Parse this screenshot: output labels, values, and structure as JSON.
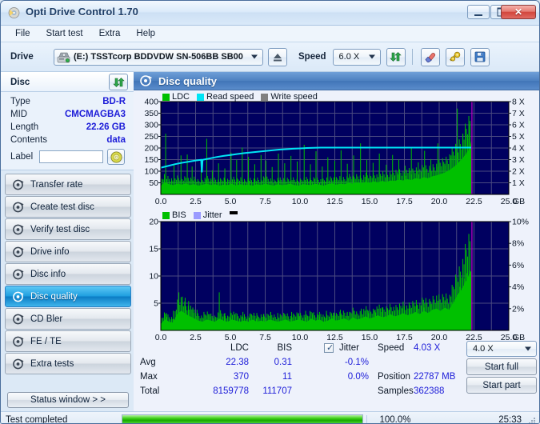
{
  "window": {
    "title": "Opti Drive Control 1.70",
    "icon": "disc-icon",
    "buttons": {
      "minimize": "minimize-icon",
      "maximize": "maximize-icon",
      "close": "close-icon"
    }
  },
  "menubar": {
    "items": [
      "File",
      "Start test",
      "Extra",
      "Help"
    ]
  },
  "toolbar": {
    "drive_label": "Drive",
    "drive_value": "(E:)   TSSTcorp BDDVDW SN-506BB SB00",
    "eject_icon": "eject-icon",
    "speed_label": "Speed",
    "speed_value": "6.0 X",
    "refresh_icon": "refresh-icon",
    "erase_icon": "eraser-icon",
    "settings_icon": "settings-icon",
    "save_icon": "save-icon"
  },
  "disc_panel": {
    "header": "Disc",
    "refresh_icon": "refresh-icon",
    "rows": [
      {
        "key": "Type",
        "value": "BD-R"
      },
      {
        "key": "MID",
        "value": "CMCMAGBA3"
      },
      {
        "key": "Length",
        "value": "22.26 GB"
      },
      {
        "key": "Contents",
        "value": "data"
      }
    ],
    "label_key": "Label",
    "label_value": "",
    "label_placeholder": "",
    "label_icon": "disc-icon"
  },
  "nav": {
    "items": [
      {
        "label": "Transfer rate",
        "icon": "disc-transfer-icon",
        "active": false
      },
      {
        "label": "Create test disc",
        "icon": "disc-create-icon",
        "active": false
      },
      {
        "label": "Verify test disc",
        "icon": "disc-verify-icon",
        "active": false
      },
      {
        "label": "Drive info",
        "icon": "drive-info-icon",
        "active": false
      },
      {
        "label": "Disc info",
        "icon": "disc-info-icon",
        "active": false
      },
      {
        "label": "Disc quality",
        "icon": "disc-quality-icon",
        "active": true
      },
      {
        "label": "CD Bler",
        "icon": "disc-bler-icon",
        "active": false
      },
      {
        "label": "FE / TE",
        "icon": "disc-fete-icon",
        "active": false
      },
      {
        "label": "Extra tests",
        "icon": "disc-extra-icon",
        "active": false
      }
    ],
    "status_window_button": "Status window > >"
  },
  "main": {
    "header_title": "Disc quality",
    "header_icon": "disc-quality-icon"
  },
  "stats": {
    "col_headers": [
      "LDC",
      "BIS"
    ],
    "row_labels": [
      "Avg",
      "Max",
      "Total"
    ],
    "ldc": {
      "avg": "22.38",
      "max": "370",
      "total": "8159778"
    },
    "bis": {
      "avg": "0.31",
      "max": "11",
      "total": "111707"
    },
    "jitter": {
      "label": "Jitter",
      "checked": true,
      "avg": "-0.1%",
      "max": "0.0%"
    },
    "speed_label": "Speed",
    "speed_value": "4.03 X",
    "position_label": "Position",
    "position_value": "22787 MB",
    "samples_label": "Samples",
    "samples_value": "362388",
    "speed_select": "4.0 X",
    "start_full": "Start full",
    "start_part": "Start part"
  },
  "statusbar": {
    "text": "Test completed",
    "percent": "100.0%",
    "progress": 100,
    "elapsed": "25:33",
    "grip_icon": "resize-grip-icon"
  },
  "colors": {
    "ldc_green": "#00c000",
    "read_speed_cyan": "#00e5f5",
    "write_speed_gray": "#808080",
    "bis_green": "#00c000",
    "jitter_blue": "#9a9aff",
    "plot_bg": "#000060",
    "grid": "#4a4a80",
    "marker_magenta": "#c000c0"
  },
  "chart_data": [
    {
      "type": "area",
      "id": "ldc-chart",
      "title": "",
      "xlabel": "GB",
      "ylabel": "",
      "xlim": [
        0,
        25
      ],
      "ylim": [
        0,
        400
      ],
      "y2lim": [
        0,
        8
      ],
      "y2label": "X",
      "grid": true,
      "legend_position": "top-left",
      "legend": [
        "LDC",
        "Read speed",
        "Write speed"
      ],
      "xticks": [
        "0.0",
        "2.5",
        "5.0",
        "7.5",
        "10.0",
        "12.5",
        "15.0",
        "17.5",
        "20.0",
        "22.5",
        "25.0"
      ],
      "yticks": [
        "50",
        "100",
        "150",
        "200",
        "250",
        "300",
        "350",
        "400"
      ],
      "y2ticks": [
        "1 X",
        "2 X",
        "3 X",
        "4 X",
        "5 X",
        "6 X",
        "7 X",
        "8 X"
      ],
      "data_end_x": 22.3,
      "series": [
        {
          "name": "LDC",
          "type": "area",
          "color": "#00c000",
          "x": [
            0.0,
            0.3,
            0.6,
            0.9,
            1.2,
            1.5,
            1.8,
            2.1,
            2.4,
            2.7,
            3.0,
            3.3,
            3.6,
            3.9,
            4.2,
            4.5,
            4.8,
            5.1,
            5.4,
            5.7,
            6.0,
            6.3,
            6.6,
            6.9,
            7.2,
            7.5,
            7.8,
            8.1,
            8.4,
            8.7,
            9.0,
            9.3,
            9.6,
            9.9,
            10.2,
            10.5,
            10.8,
            11.1,
            11.4,
            11.7,
            12.0,
            12.3,
            12.6,
            12.9,
            13.2,
            13.5,
            13.8,
            14.1,
            14.4,
            14.7,
            15.0,
            15.3,
            15.6,
            15.9,
            16.2,
            16.5,
            16.8,
            17.1,
            17.4,
            17.7,
            18.0,
            18.3,
            18.6,
            18.9,
            19.2,
            19.5,
            19.8,
            20.1,
            20.4,
            20.7,
            21.0,
            21.3,
            21.6,
            21.9,
            22.2,
            22.3
          ],
          "values": [
            38,
            52,
            44,
            40,
            46,
            42,
            48,
            40,
            44,
            38,
            42,
            46,
            40,
            44,
            38,
            42,
            40,
            46,
            38,
            44,
            40,
            42,
            38,
            44,
            40,
            46,
            42,
            38,
            44,
            40,
            42,
            46,
            40,
            38,
            44,
            42,
            40,
            46,
            42,
            38,
            44,
            48,
            42,
            46,
            44,
            50,
            46,
            52,
            48,
            54,
            50,
            56,
            52,
            58,
            54,
            60,
            58,
            64,
            60,
            66,
            62,
            70,
            66,
            74,
            70,
            78,
            82,
            88,
            94,
            104,
            116,
            132,
            150,
            172,
            200,
            230
          ]
        },
        {
          "name": "LDC spikes",
          "type": "spikes",
          "color": "#00c000",
          "x": [
            0.35,
            0.95,
            1.45,
            1.9,
            2.25,
            2.9,
            3.3,
            3.7,
            4.15,
            4.6,
            5.05,
            5.45,
            5.85,
            6.3,
            6.75,
            7.2,
            7.55,
            8.0,
            8.45,
            8.9,
            9.35,
            9.8,
            10.3,
            10.75,
            11.15,
            11.6,
            12.0,
            12.5,
            12.95,
            13.4,
            13.85,
            14.35,
            14.8,
            15.25,
            15.7,
            16.2,
            16.65,
            17.1,
            17.55,
            18.0,
            18.5,
            18.95,
            19.4,
            19.9,
            20.4,
            20.85,
            21.3,
            21.7,
            22.05,
            22.2
          ],
          "values": [
            262,
            128,
            168,
            172,
            120,
            150,
            240,
            104,
            134,
            112,
            180,
            148,
            202,
            162,
            130,
            170,
            146,
            118,
            176,
            134,
            166,
            142,
            214,
            130,
            186,
            120,
            160,
            144,
            190,
            132,
            168,
            220,
            148,
            136,
            176,
            128,
            170,
            150,
            124,
            200,
            138,
            188,
            152,
            220,
            132,
            168,
            370,
            262,
            240,
            300
          ]
        },
        {
          "name": "Read speed",
          "type": "line",
          "color": "#00e5f5",
          "axis": "right",
          "x": [
            0.0,
            0.5,
            1.0,
            1.5,
            2.0,
            2.5,
            2.9,
            2.95,
            3.0,
            3.5,
            4.0,
            4.5,
            5.0,
            5.5,
            6.0,
            6.5,
            7.0,
            7.5,
            8.0,
            8.5,
            9.0,
            9.5,
            10.0,
            10.5,
            11.0,
            11.5,
            12.0,
            13.0,
            14.0,
            15.0,
            16.0,
            17.0,
            18.0,
            19.0,
            20.0,
            21.0,
            22.0,
            22.3
          ],
          "values_x_axis": [
            2.3,
            2.45,
            2.6,
            2.72,
            2.82,
            2.92,
            2.98,
            1.9,
            2.98,
            3.1,
            3.22,
            3.32,
            3.4,
            3.48,
            3.56,
            3.62,
            3.68,
            3.74,
            3.8,
            3.86,
            3.9,
            3.94,
            3.97,
            4.0,
            4.02,
            4.03,
            4.03,
            4.03,
            4.03,
            4.03,
            4.03,
            4.03,
            4.03,
            4.03,
            4.03,
            4.03,
            4.03,
            4.03
          ]
        }
      ],
      "marker_lines": [
        {
          "x": 22.35,
          "color": "#c000c0"
        }
      ]
    },
    {
      "type": "area",
      "id": "bis-chart",
      "title": "",
      "xlabel": "GB",
      "ylabel": "",
      "xlim": [
        0,
        25
      ],
      "ylim": [
        0,
        20
      ],
      "y2lim": [
        0,
        10
      ],
      "y2label": "%",
      "grid": true,
      "legend_position": "top-left",
      "legend": [
        "BIS",
        "Jitter"
      ],
      "xticks": [
        "0.0",
        "2.5",
        "5.0",
        "7.5",
        "10.0",
        "12.5",
        "15.0",
        "17.5",
        "20.0",
        "22.5",
        "25.0"
      ],
      "yticks": [
        "5",
        "10",
        "15",
        "20"
      ],
      "y2ticks": [
        "2%",
        "4%",
        "6%",
        "8%",
        "10%"
      ],
      "data_end_x": 22.3,
      "series": [
        {
          "name": "BIS",
          "type": "area",
          "color": "#00c000",
          "x": [
            0.0,
            0.3,
            0.6,
            0.9,
            1.2,
            1.5,
            1.8,
            2.1,
            2.4,
            2.7,
            3.0,
            3.3,
            3.6,
            3.9,
            4.2,
            4.5,
            4.8,
            5.1,
            5.4,
            5.7,
            6.0,
            6.3,
            6.6,
            6.9,
            7.2,
            7.5,
            7.8,
            8.1,
            8.4,
            8.7,
            9.0,
            9.3,
            9.6,
            9.9,
            10.2,
            10.5,
            10.8,
            11.1,
            11.4,
            11.7,
            12.0,
            12.3,
            12.6,
            12.9,
            13.2,
            13.5,
            13.8,
            14.1,
            14.4,
            14.7,
            15.0,
            15.3,
            15.6,
            15.9,
            16.2,
            16.5,
            16.8,
            17.1,
            17.4,
            17.7,
            18.0,
            18.3,
            18.6,
            18.9,
            19.2,
            19.5,
            19.8,
            20.1,
            20.4,
            20.7,
            21.0,
            21.3,
            21.6,
            21.9,
            22.1,
            22.3
          ],
          "values": [
            1.2,
            2.0,
            1.6,
            1.4,
            3.2,
            3.6,
            3.0,
            2.6,
            2.2,
            1.8,
            1.6,
            2.0,
            1.8,
            1.6,
            2.2,
            1.8,
            1.6,
            2.0,
            1.8,
            1.6,
            1.8,
            1.6,
            2.0,
            1.6,
            1.8,
            1.6,
            2.0,
            1.8,
            1.6,
            1.8,
            2.0,
            1.6,
            1.8,
            2.0,
            1.8,
            1.6,
            2.2,
            1.8,
            2.0,
            1.6,
            1.8,
            2.2,
            1.8,
            2.0,
            2.2,
            1.8,
            2.4,
            2.0,
            2.2,
            2.6,
            2.2,
            2.4,
            2.8,
            2.4,
            2.6,
            3.0,
            2.6,
            2.8,
            3.2,
            2.8,
            3.0,
            3.4,
            3.0,
            3.6,
            3.2,
            3.8,
            4.0,
            3.6,
            4.2,
            3.8,
            5.0,
            6.5,
            7.5,
            9.0,
            10.0,
            11.0
          ]
        },
        {
          "name": "BIS spikes",
          "type": "spikes",
          "color": "#00c000",
          "x": [
            0.4,
            0.9,
            1.3,
            1.55,
            1.75,
            2.0,
            2.3,
            2.6,
            3.1,
            3.5,
            4.2,
            4.6,
            5.0,
            5.4,
            5.9,
            6.4,
            6.9,
            7.4,
            7.9,
            8.4,
            8.9,
            9.4,
            9.9,
            10.4,
            10.9,
            11.4,
            11.9,
            12.4,
            12.9,
            13.4,
            13.9,
            14.4,
            14.9,
            15.4,
            15.9,
            16.4,
            16.9,
            17.4,
            17.9,
            18.4,
            18.9,
            19.4,
            19.9,
            20.4,
            20.9,
            21.2,
            21.5,
            21.8,
            22.0,
            22.2
          ],
          "values": [
            3.2,
            3.6,
            7.0,
            6.2,
            6.0,
            5.4,
            4.2,
            3.8,
            3.4,
            3.0,
            7.0,
            3.2,
            3.6,
            3.2,
            3.4,
            3.0,
            3.2,
            3.0,
            3.4,
            3.2,
            3.0,
            3.4,
            3.2,
            3.6,
            3.2,
            3.4,
            3.6,
            3.2,
            3.8,
            3.4,
            3.6,
            4.0,
            3.6,
            3.8,
            4.2,
            3.8,
            4.0,
            4.4,
            4.0,
            4.6,
            4.2,
            4.8,
            5.0,
            4.6,
            5.2,
            6.0,
            8.0,
            9.5,
            10.5,
            11.0
          ]
        },
        {
          "name": "Jitter",
          "type": "line",
          "color": "#9a9aff",
          "axis": "right",
          "x": [],
          "values": []
        }
      ],
      "marker_lines": [
        {
          "x": 22.35,
          "color": "#c000c0"
        }
      ]
    }
  ]
}
